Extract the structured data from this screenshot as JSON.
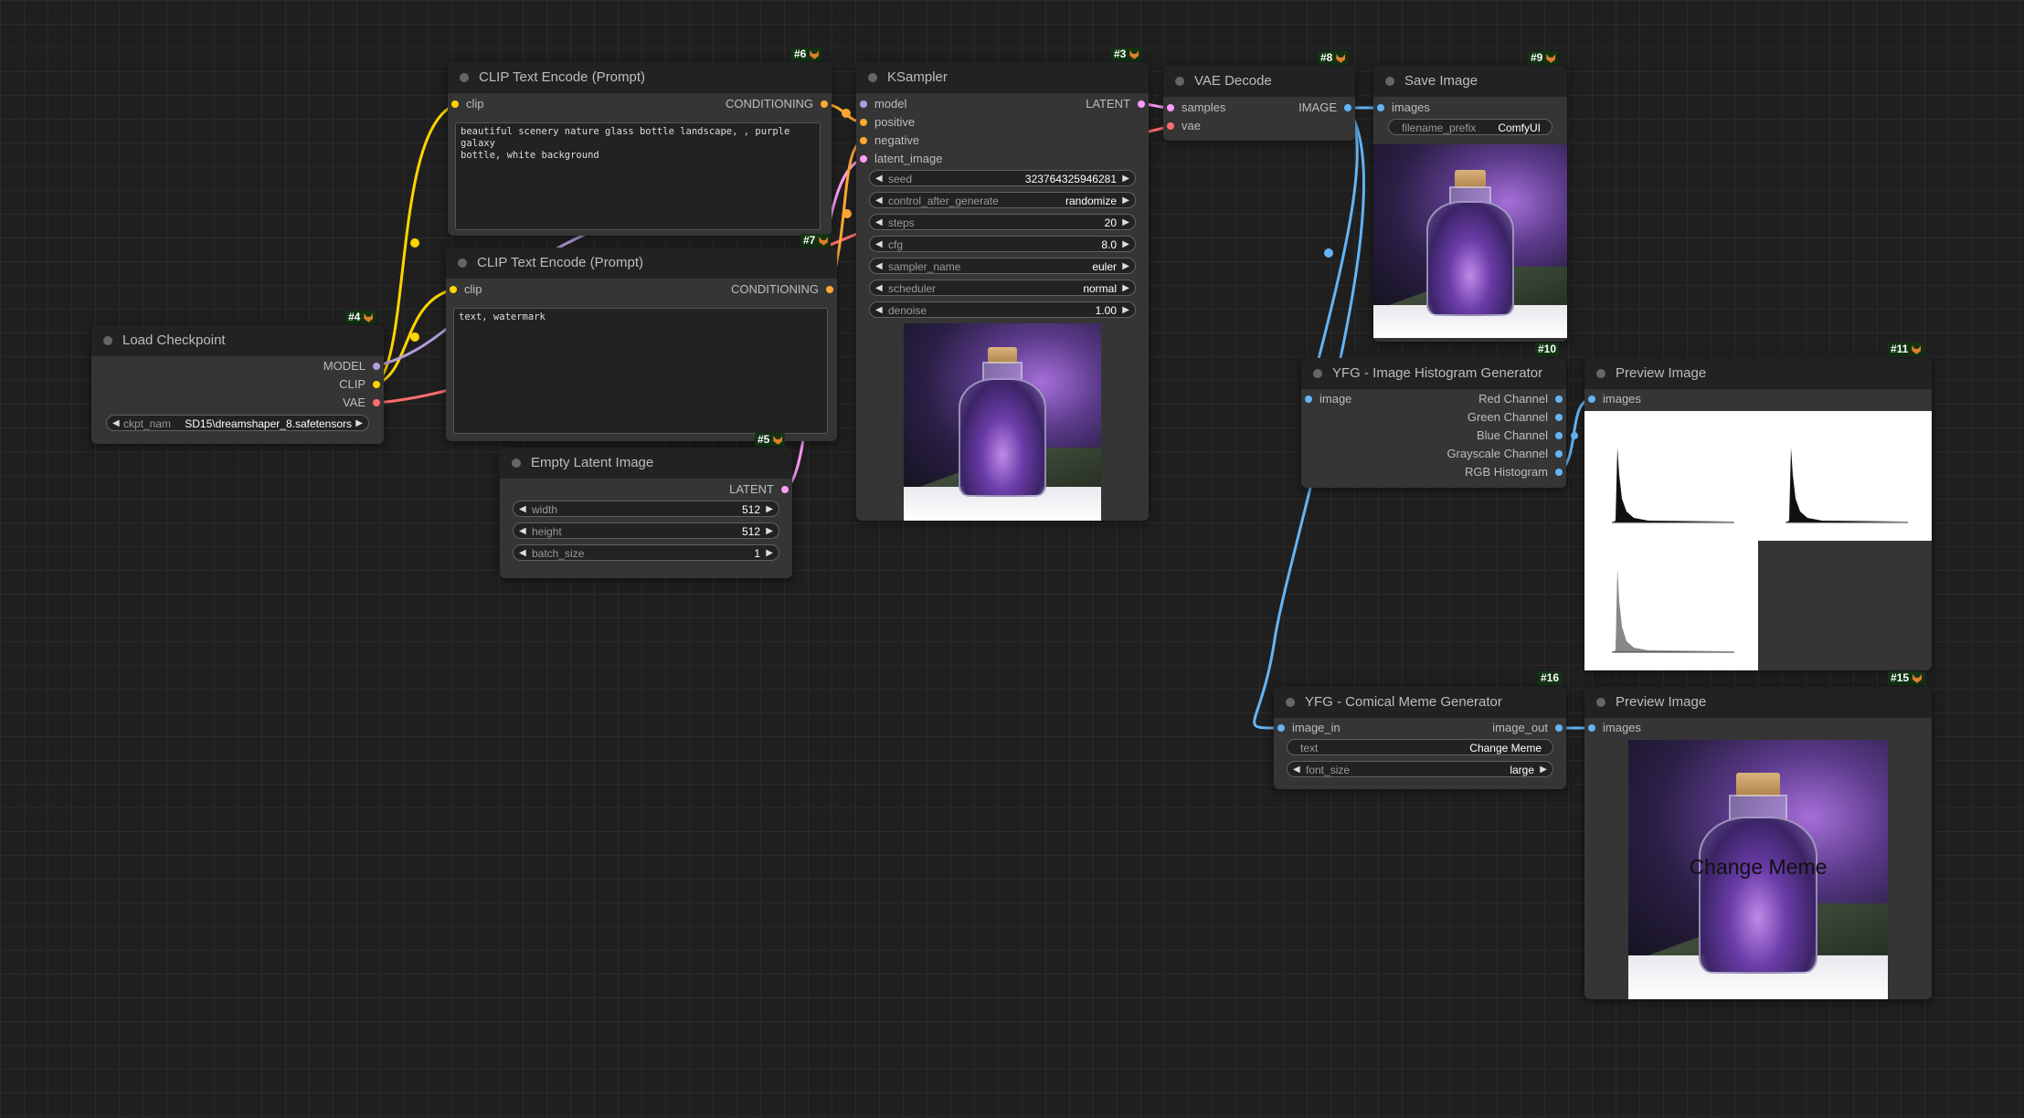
{
  "colors": {
    "clip": "#ffd500",
    "model": "#b39ddb",
    "vae": "#ff6e6e",
    "latent": "#ff9cf9",
    "image": "#64b5f6",
    "conditioning": "#ffa931"
  },
  "nodes": {
    "clip6": {
      "id": "#6",
      "title": "CLIP Text Encode (Prompt)",
      "in": "clip",
      "out": "CONDITIONING",
      "text": "beautiful scenery nature glass bottle landscape, , purple galaxy\nbottle, white background"
    },
    "clip7": {
      "id": "#7",
      "title": "CLIP Text Encode (Prompt)",
      "in": "clip",
      "out": "CONDITIONING",
      "text": "text, watermark"
    },
    "ckpt": {
      "id": "#4",
      "title": "Load Checkpoint",
      "outs": [
        "MODEL",
        "CLIP",
        "VAE"
      ],
      "widget_label": "ckpt_nam",
      "widget_value": "SD15\\dreamshaper_8.safetensors"
    },
    "latent": {
      "id": "#5",
      "title": "Empty Latent Image",
      "out": "LATENT",
      "widgets": [
        {
          "label": "width",
          "value": "512"
        },
        {
          "label": "height",
          "value": "512"
        },
        {
          "label": "batch_size",
          "value": "1"
        }
      ]
    },
    "ksampler": {
      "id": "#3",
      "title": "KSampler",
      "ins": [
        "model",
        "positive",
        "negative",
        "latent_image"
      ],
      "out": "LATENT",
      "widgets": [
        {
          "label": "seed",
          "value": "323764325946281"
        },
        {
          "label": "control_after_generate",
          "value": "randomize"
        },
        {
          "label": "steps",
          "value": "20"
        },
        {
          "label": "cfg",
          "value": "8.0"
        },
        {
          "label": "sampler_name",
          "value": "euler"
        },
        {
          "label": "scheduler",
          "value": "normal"
        },
        {
          "label": "denoise",
          "value": "1.00"
        }
      ]
    },
    "vae": {
      "id": "#8",
      "title": "VAE Decode",
      "ins": [
        "samples",
        "vae"
      ],
      "out": "IMAGE"
    },
    "save": {
      "id": "#9",
      "title": "Save Image",
      "in": "images",
      "widget_label": "filename_prefix",
      "widget_value": "ComfyUI"
    },
    "hist": {
      "id": "#10",
      "title": "YFG - Image Histogram Generator",
      "in": "image",
      "outs": [
        "Red Channel",
        "Green Channel",
        "Blue Channel",
        "Grayscale Channel",
        "RGB Histogram"
      ]
    },
    "prev11": {
      "id": "#11",
      "title": "Preview Image",
      "in": "images"
    },
    "meme": {
      "id": "#16",
      "title": "YFG - Comical Meme Generator",
      "in": "image_in",
      "out": "image_out",
      "widgets": [
        {
          "label": "text",
          "value": "Change Meme"
        },
        {
          "label": "font_size",
          "value": "large"
        }
      ]
    },
    "prev15": {
      "id": "#15",
      "title": "Preview Image",
      "in": "images",
      "meme_text": "Change Meme"
    }
  }
}
